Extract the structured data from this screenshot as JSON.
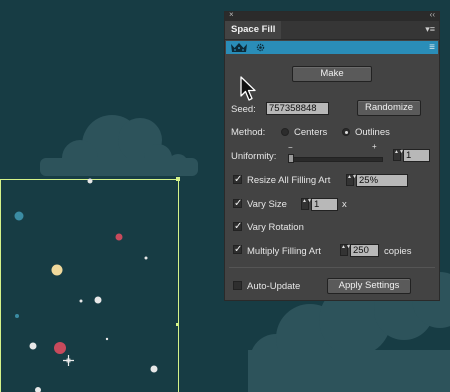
{
  "panel": {
    "title_close": "×",
    "title_collapse": "‹‹",
    "tab_label": "Space Fill",
    "tab_menu": "▾≡",
    "strip_menu": "≡"
  },
  "make_button": {
    "label": "Make"
  },
  "seed": {
    "label": "Seed:",
    "value": "757358848"
  },
  "randomize_button": {
    "label": "Randomize"
  },
  "method": {
    "label": "Method:",
    "options": [
      "Centers",
      "Outlines"
    ],
    "selected": "Outlines"
  },
  "uniformity": {
    "label": "Uniformity:",
    "minus": "−",
    "plus": "+",
    "value": "1",
    "slider_level": 0
  },
  "resize": {
    "label": "Resize All Filling Art",
    "checked": true,
    "value": "25%"
  },
  "vary_size": {
    "label": "Vary Size",
    "checked": true,
    "value": "1",
    "unit": "x"
  },
  "vary_rotation": {
    "label": "Vary Rotation",
    "checked": true
  },
  "multiply": {
    "label": "Multiply Filling Art",
    "checked": true,
    "value": "250",
    "unit": "copies"
  },
  "auto_update": {
    "label": "Auto-Update",
    "checked": false
  },
  "apply_button": {
    "label": "Apply Settings"
  },
  "checkmark": "✓",
  "stepper_arrows": "▲▼",
  "colors": {
    "background": "#173c44",
    "cloud": "#2d535b",
    "panel": "#434343",
    "header_strip": "#2a8db8",
    "selection_frame": "#d4f28a",
    "dot_pink": "#c84a5c",
    "dot_cream": "#f0d99c",
    "dot_teal": "#3b8ca3",
    "dot_white": "#e8e8e8"
  }
}
